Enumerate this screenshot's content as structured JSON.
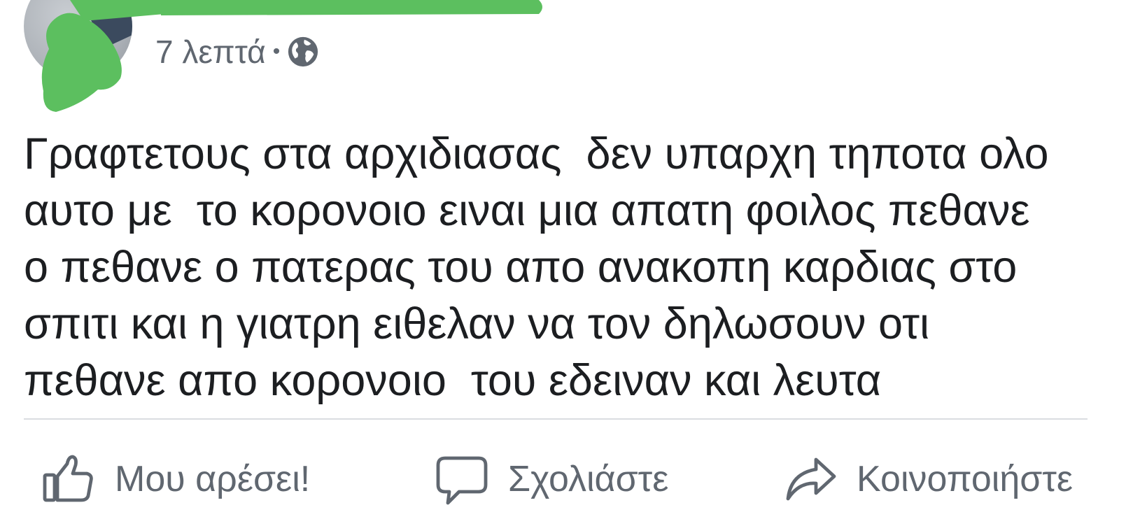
{
  "post": {
    "timestamp": "7 λεπτά",
    "separator": "•",
    "privacy_icon": "globe-icon",
    "text": "Γραφτετους στα αρχιδιασας  δεν υπαρχη τηποτα ολο\nαυτο με  το κορονοιο ειναι μια απατη φοιλος πεθανε\nο πεθανε ο πατερας του απο ανακοπη καρδιας στο\nσπιτι και η γιατρη ειθελαν να τον δηλωσουν οτι\nπεθανε απο κορονοιο  του εδειναν και λευτα"
  },
  "actions": {
    "like": {
      "label": "Μου αρέσει!",
      "icon": "thumbs-up-icon"
    },
    "comment": {
      "label": "Σχολιάστε",
      "icon": "speech-bubble-icon"
    },
    "share": {
      "label": "Κοινοποιήστε",
      "icon": "share-arrow-icon"
    }
  },
  "colors": {
    "redaction": "#5cbf5f",
    "text": "#1c1e21",
    "secondary_text": "#606770",
    "divider": "#dadde1"
  }
}
